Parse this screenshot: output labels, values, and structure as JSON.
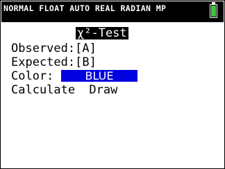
{
  "status_bar": {
    "mode_text": "NORMAL FLOAT AUTO REAL RADIAN MP",
    "battery_color": "#3ec43e",
    "battery_level": 1.0
  },
  "screen": {
    "title": "χ²-Test",
    "observed": {
      "label": "Observed:",
      "value": "[A]"
    },
    "expected": {
      "label": "Expected:",
      "value": "[B]"
    },
    "color": {
      "label": "Color:",
      "value": "BLUE",
      "swatch": "#0000e0"
    },
    "actions": {
      "calculate": "Calculate",
      "draw": "Draw"
    }
  }
}
